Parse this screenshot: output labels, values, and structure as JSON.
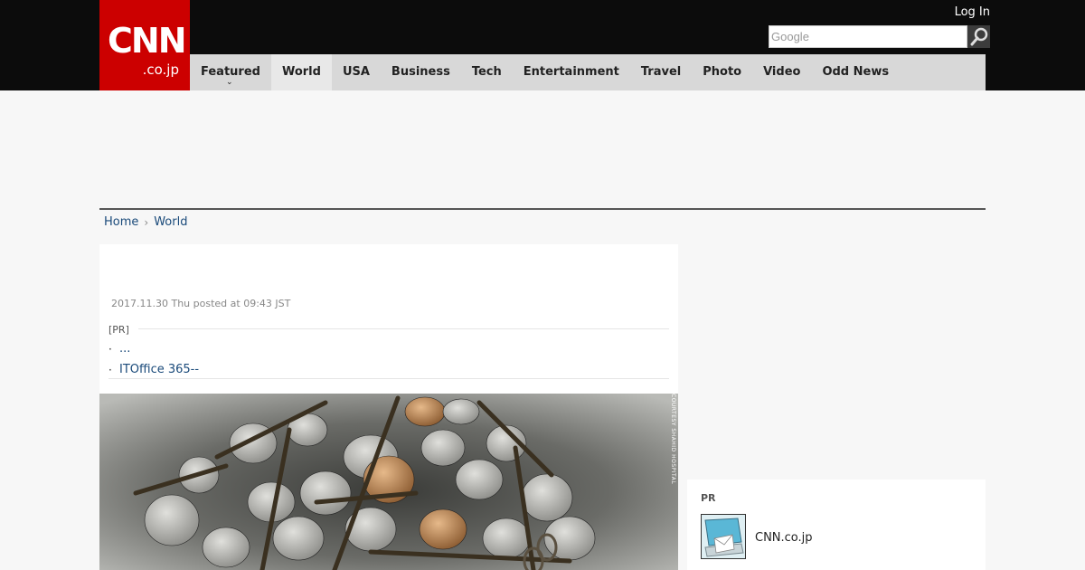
{
  "header": {
    "logo_main": "CNN",
    "logo_sub": ".co.jp",
    "login_label": "Log In",
    "search_placeholder": "Google"
  },
  "nav": {
    "items": [
      {
        "label": "Featured"
      },
      {
        "label": "World"
      },
      {
        "label": "USA"
      },
      {
        "label": "Business"
      },
      {
        "label": "Tech"
      },
      {
        "label": "Entertainment"
      },
      {
        "label": "Travel"
      },
      {
        "label": "Photo"
      },
      {
        "label": "Video"
      },
      {
        "label": "Odd News"
      }
    ],
    "active_index": 1
  },
  "breadcrumb": {
    "home": "Home",
    "current": "World"
  },
  "article": {
    "posted": "2017.11.30 Thu posted at 09:43 JST",
    "pr_label": "[PR]",
    "pr_links": [
      "...",
      "ITOffice 365--"
    ]
  },
  "photo": {
    "credit": "COURTESY SHAHID HOSPITAL"
  },
  "sidebar": {
    "pr_label": "PR",
    "item_name": "CNN.co.jp"
  },
  "colors": {
    "brand_red": "#cc0000",
    "header_bg": "#0c0c0c",
    "nav_bg": "#d8d8d8",
    "link": "#1a4a7a"
  }
}
